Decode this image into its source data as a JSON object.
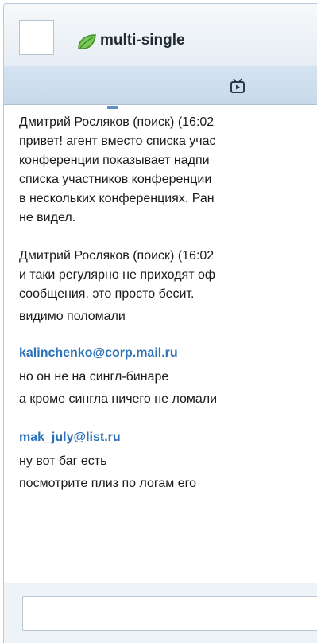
{
  "header": {
    "title": "multi-single",
    "status_icon": "leaf-status-icon",
    "accent": "#4fa63a"
  },
  "toolbar": {
    "icon": "tv-icon"
  },
  "messages": [
    {
      "sender": "",
      "lines": [
        "Дмитрий Росляков (поиск) (16:02",
        "привет! агент вместо списка учас",
        "конференции показывает надпи",
        "списка участников конференции",
        "в нескольких конференциях. Ран",
        "не видел."
      ]
    },
    {
      "sender": "",
      "lines": [
        "Дмитрий Росляков (поиск) (16:02",
        "и таки регулярно не приходят оф",
        "сообщения. это просто бесит.",
        "видимо поломали"
      ]
    },
    {
      "sender": "kalinchenko@corp.mail.ru",
      "lines": [
        "но он не на сингл-бинаре",
        "а кроме сингла ничего не ломали"
      ]
    },
    {
      "sender": "mak_july@list.ru",
      "lines": [
        "ну вот баг есть",
        "посмотрите плиз по логам его"
      ]
    }
  ],
  "input": {
    "value": ""
  },
  "colors": {
    "sender_link": "#2d72b8",
    "toolbar_bg": "#c7d9ea"
  }
}
